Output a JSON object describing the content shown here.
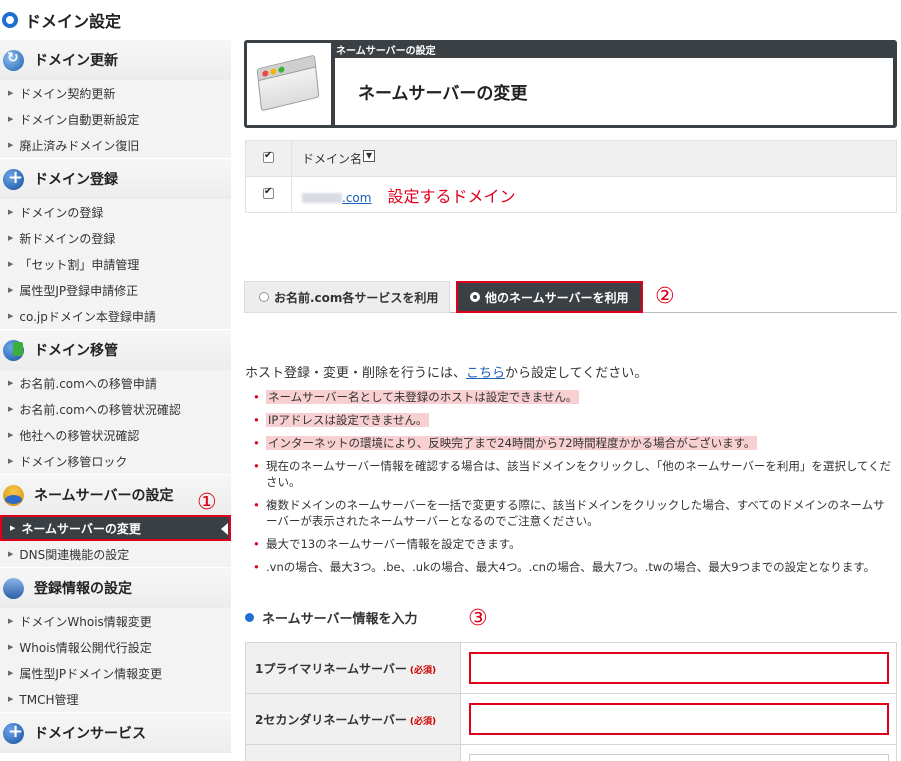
{
  "page_title": "ドメイン設定",
  "sidebar": {
    "sections": [
      {
        "heading": "ドメイン更新",
        "icon": "refresh-icon",
        "items": [
          "ドメイン契約更新",
          "ドメイン自動更新設定",
          "廃止済みドメイン復旧"
        ]
      },
      {
        "heading": "ドメイン登録",
        "icon": "plus-icon",
        "items": [
          "ドメインの登録",
          "新ドメインの登録",
          "「セット割」申請管理",
          "属性型JP登録申請修正",
          "co.jpドメイン本登録申請"
        ]
      },
      {
        "heading": "ドメイン移管",
        "icon": "transfer-icon",
        "items": [
          "お名前.comへの移管申請",
          "お名前.comへの移管状況確認",
          "他社への移管状況確認",
          "ドメイン移管ロック"
        ]
      },
      {
        "heading": "ネームサーバーの設定",
        "icon": "nameserver-icon",
        "items": [
          "ネームサーバーの変更",
          "DNS関連機能の設定"
        ]
      },
      {
        "heading": "登録情報の設定",
        "icon": "stack-icon",
        "items": [
          "ドメインWhois情報変更",
          "Whois情報公開代行設定",
          "属性型JPドメイン情報変更",
          "TMCH管理"
        ]
      },
      {
        "heading": "ドメインサービス",
        "icon": "plus-icon",
        "items": []
      }
    ],
    "active_item": "ネームサーバーの変更"
  },
  "annotations": {
    "one": "①",
    "two": "②",
    "three": "③"
  },
  "header": {
    "subtitle": "ネームサーバーの設定",
    "title": "ネームサーバーの変更"
  },
  "domain_table": {
    "column_header": "ドメイン名",
    "sort_glyph": "▼",
    "row_link": ".com",
    "row_note": "設定するドメイン"
  },
  "tabs": [
    {
      "label": "お名前.com各サービスを利用",
      "selected": false
    },
    {
      "label": "他のネームサーバーを利用",
      "selected": true
    }
  ],
  "info": {
    "prefix": "ホスト登録・変更・削除を行うには、",
    "link": "こちら",
    "suffix": "から設定してください。"
  },
  "notes": [
    {
      "text": "ネームサーバー名として未登録のホストは設定できません。",
      "highlight": true
    },
    {
      "text": "IPアドレスは設定できません。",
      "highlight": true
    },
    {
      "text": "インターネットの環境により、反映完了まで24時間から72時間程度かかる場合がございます。",
      "highlight": true
    },
    {
      "text": "現在のネームサーバー情報を確認する場合は、該当ドメインをクリックし、「他のネームサーバーを利用」を選択してください。",
      "highlight": false
    },
    {
      "text": "複数ドメインのネームサーバーを一括で変更する際に、該当ドメインをクリックした場合、すべてのドメインのネームサーバーが表示されたネームサーバーとなるのでご注意ください。",
      "highlight": false
    },
    {
      "text": "最大で13のネームサーバー情報を設定できます。",
      "highlight": false
    },
    {
      "text": ".vnの場合、最大3つ。.be、.ukの場合、最大4つ。.cnの場合、最大7つ。.twの場合、最大9つまでの設定となります。",
      "highlight": false
    }
  ],
  "ns_section": {
    "heading": "ネームサーバー情報を入力",
    "required_label": "(必須)",
    "rows": [
      {
        "label": "1プライマリネームサーバー",
        "value": ""
      },
      {
        "label": "2セカンダリネームサーバー",
        "value": ""
      },
      {
        "label": "",
        "value": ""
      }
    ]
  },
  "colors": {
    "accent_red": "#e0001b",
    "dark_panel": "#3b4045",
    "link_blue": "#1a5eb6",
    "brand_blue": "#1f6fd1"
  }
}
